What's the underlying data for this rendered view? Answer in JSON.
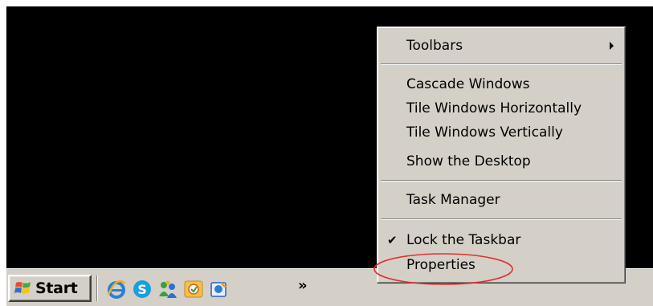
{
  "taskbar": {
    "start_label": "Start",
    "quick_launch": [
      {
        "icon": "internet-explorer-icon"
      },
      {
        "icon": "skype-icon"
      },
      {
        "icon": "messenger-icon"
      },
      {
        "icon": "outlook-icon"
      },
      {
        "icon": "app-icon"
      }
    ],
    "overflow_label": "»"
  },
  "context_menu": {
    "items": [
      {
        "label": "Toolbars",
        "has_submenu": true
      },
      {
        "label": "Cascade Windows"
      },
      {
        "label": "Tile Windows Horizontally"
      },
      {
        "label": "Tile Windows Vertically"
      },
      {
        "label": "Show the Desktop"
      },
      {
        "label": "Task Manager"
      },
      {
        "label": "Lock the Taskbar",
        "checked": true
      },
      {
        "label": "Properties",
        "highlighted": true
      }
    ]
  },
  "colors": {
    "desktop": "#000000",
    "taskbar": "#d4d0c8",
    "menu": "#d4d0c8",
    "highlight_ellipse": "#e03030"
  }
}
